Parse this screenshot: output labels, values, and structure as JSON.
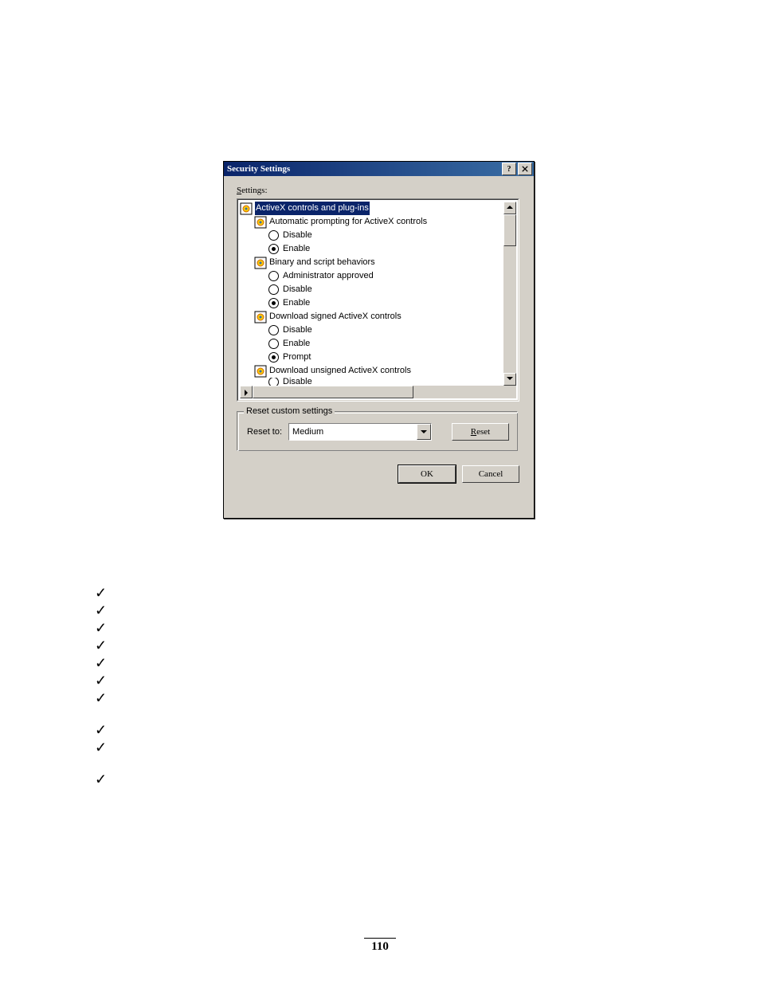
{
  "dialog": {
    "title": "Security Settings",
    "settings_label": "Settings:",
    "tree": {
      "category": "ActiveX controls and plug-ins",
      "items": [
        {
          "label": "Automatic prompting for ActiveX controls",
          "options": [
            "Disable",
            "Enable"
          ],
          "selected": "Enable"
        },
        {
          "label": "Binary and script behaviors",
          "options": [
            "Administrator approved",
            "Disable",
            "Enable"
          ],
          "selected": "Enable"
        },
        {
          "label": "Download signed ActiveX controls",
          "options": [
            "Disable",
            "Enable",
            "Prompt"
          ],
          "selected": "Prompt"
        },
        {
          "label": "Download unsigned ActiveX controls",
          "options_partial": [
            "Disable"
          ],
          "selected": ""
        }
      ]
    },
    "reset_group": {
      "title": "Reset custom settings",
      "reset_to_label": "Reset to:",
      "reset_to_value": "Medium",
      "reset_button": "Reset"
    },
    "ok_button": "OK",
    "cancel_button": "Cancel"
  },
  "page_number": "110"
}
